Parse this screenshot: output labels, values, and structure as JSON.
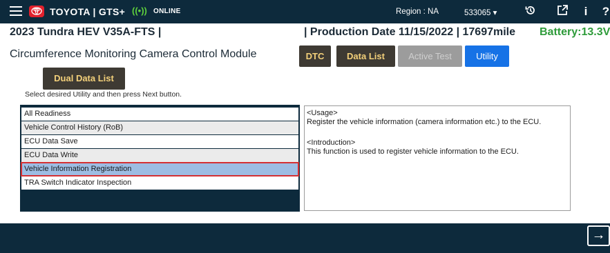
{
  "header": {
    "brand": "TOYOTA | GTS+",
    "online_icon": "((•))",
    "online_label": "ONLINE",
    "region": "Region : NA",
    "vin_select": "533065 ▾",
    "icons": [
      "history-icon",
      "external-link-icon",
      "info-icon",
      "help-icon"
    ]
  },
  "vehicle": {
    "model": "2023 Tundra HEV V35A-FTS  |",
    "production": "|  Production Date 11/15/2022  |  17697mile",
    "battery": "Battery:13.3V"
  },
  "module": {
    "title": "Circumference Monitoring Camera Control Module"
  },
  "tabs": [
    {
      "label": "DTC"
    },
    {
      "label": "Data List"
    },
    {
      "label": "Active Test"
    },
    {
      "label": "Utility"
    }
  ],
  "dual_data_list": {
    "label": "Dual Data List"
  },
  "instruction": "Select desired Utility and then press Next button.",
  "utilities": [
    {
      "label": "All Readiness"
    },
    {
      "label": "Vehicle Control History (RoB)"
    },
    {
      "label": "ECU Data Save"
    },
    {
      "label": "ECU Data Write"
    },
    {
      "label": "Vehicle Information Registration"
    },
    {
      "label": "TRA Switch Indicator Inspection"
    }
  ],
  "info": {
    "usage_heading": "<Usage>",
    "usage_text": "Register the vehicle information (camera information etc.) to the ECU.",
    "intro_heading": "<Introduction>",
    "intro_text": "This function is used to register vehicle information to the ECU."
  },
  "footer": {
    "next_icon": "→"
  },
  "colors": {
    "topbar": "#0d2a3c",
    "accent_blue": "#1672e6",
    "tab_dark": "#3e3a33",
    "tab_text": "#f3d07a",
    "battery_green": "#2e9b3a",
    "selection_outline": "#d43032",
    "selection_fill": "#9dbde3"
  }
}
